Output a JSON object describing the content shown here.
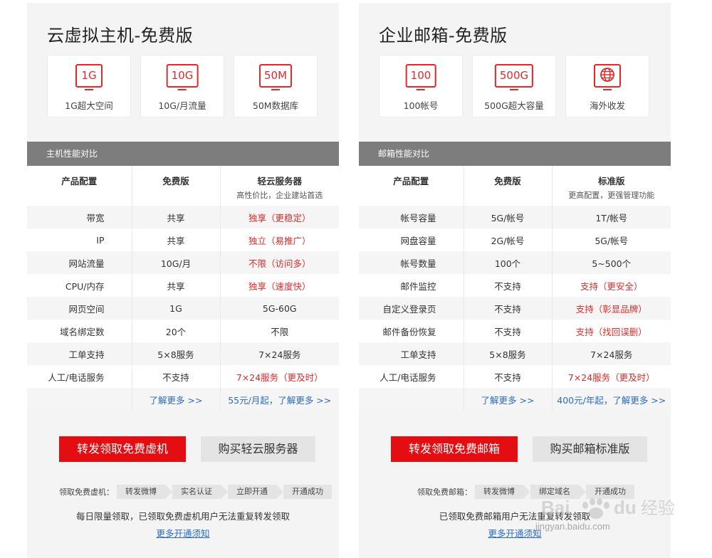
{
  "vhost": {
    "title": "云虚拟主机-免费版",
    "features": [
      {
        "icon": "1G",
        "label": "1G超大空间"
      },
      {
        "icon": "10G",
        "label": "10G/月流量"
      },
      {
        "icon": "50M",
        "label": "50M数据库"
      }
    ],
    "section": "主机性能对比",
    "table": {
      "header": {
        "col1": "产品配置",
        "col2": "免费版",
        "col3": "轻云服务器",
        "col3_sub": "高性价比，企业建站首选"
      },
      "rows": [
        {
          "name": "带宽",
          "free": "共享",
          "paid": "独享（更稳定）",
          "red": true
        },
        {
          "name": "IP",
          "free": "共享",
          "paid": "独立（易推广）",
          "red": true
        },
        {
          "name": "网站流量",
          "free": "10G/月",
          "paid": "不限（访问多）",
          "red": true
        },
        {
          "name": "CPU/内存",
          "free": "共享",
          "paid": "独享（速度快）",
          "red": true
        },
        {
          "name": "网页空间",
          "free": "1G",
          "paid": "5G-60G",
          "red": false
        },
        {
          "name": "域名绑定数",
          "free": "20个",
          "paid": "不限",
          "red": false
        },
        {
          "name": "工单支持",
          "free": "5×8服务",
          "paid": "7×24服务",
          "red": false
        },
        {
          "name": "人工/电话服务",
          "free": "不支持",
          "paid": "7×24服务（更及时）",
          "red": true
        }
      ],
      "more_free": "了解更多 >>",
      "more_paid": "55元/月起，了解更多 >>"
    },
    "btn_primary": "转发领取免费虚机",
    "btn_secondary": "购买轻云服务器",
    "steps_label": "领取免费虚机：",
    "steps": [
      "转发微博",
      "实名认证",
      "立即开通",
      "开通成功"
    ],
    "notice": "每日限量领取，已领取免费虚机用户无法重复转发领取",
    "more_link": "更多开通须知"
  },
  "mail": {
    "title": "企业邮箱-免费版",
    "features": [
      {
        "icon": "100",
        "label": "100帐号"
      },
      {
        "icon": "500G",
        "label": "500G超大容量"
      },
      {
        "icon": "globe-icon",
        "label": "海外收发"
      }
    ],
    "section": "邮箱性能对比",
    "table": {
      "header": {
        "col1": "产品配置",
        "col2": "免费版",
        "col3": "标准版",
        "col3_sub": "更高配置，更强管理功能"
      },
      "rows": [
        {
          "name": "帐号容量",
          "free": "5G/帐号",
          "paid": "1T/帐号",
          "red": false
        },
        {
          "name": "网盘容量",
          "free": "2G/帐号",
          "paid": "5G/帐号",
          "red": false
        },
        {
          "name": "帐号数量",
          "free": "100个",
          "paid": "5~500个",
          "red": false
        },
        {
          "name": "邮件监控",
          "free": "不支持",
          "paid": "支持（更安全）",
          "red": true
        },
        {
          "name": "自定义登录页",
          "free": "不支持",
          "paid": "支持（彰显品牌）",
          "red": true
        },
        {
          "name": "邮件备份恢复",
          "free": "不支持",
          "paid": "支持（找回误删）",
          "red": true
        },
        {
          "name": "工单支持",
          "free": "5×8服务",
          "paid": "7×24服务",
          "red": false
        },
        {
          "name": "人工/电话服务",
          "free": "不支持",
          "paid": "7×24服务（更及时）",
          "red": true
        }
      ],
      "more_free": "了解更多 >>",
      "more_paid": "400元/年起，了解更多 >>"
    },
    "btn_primary": "转发领取免费邮箱",
    "btn_secondary": "购买邮箱标准版",
    "steps_label": "领取免费邮箱：",
    "steps": [
      "转发微博",
      "绑定域名",
      "开通成功"
    ],
    "notice": "已领取免费邮箱用户无法重复转发领取",
    "more_link": "更多开通须知"
  },
  "watermark": {
    "brand": "Bai du 经验",
    "url": "jingyan.baidu.com"
  },
  "colors": {
    "accent": "#e40d12",
    "link": "#2a6ac9",
    "bar": "#7d7d7d",
    "panel": "#f4f4f4"
  }
}
